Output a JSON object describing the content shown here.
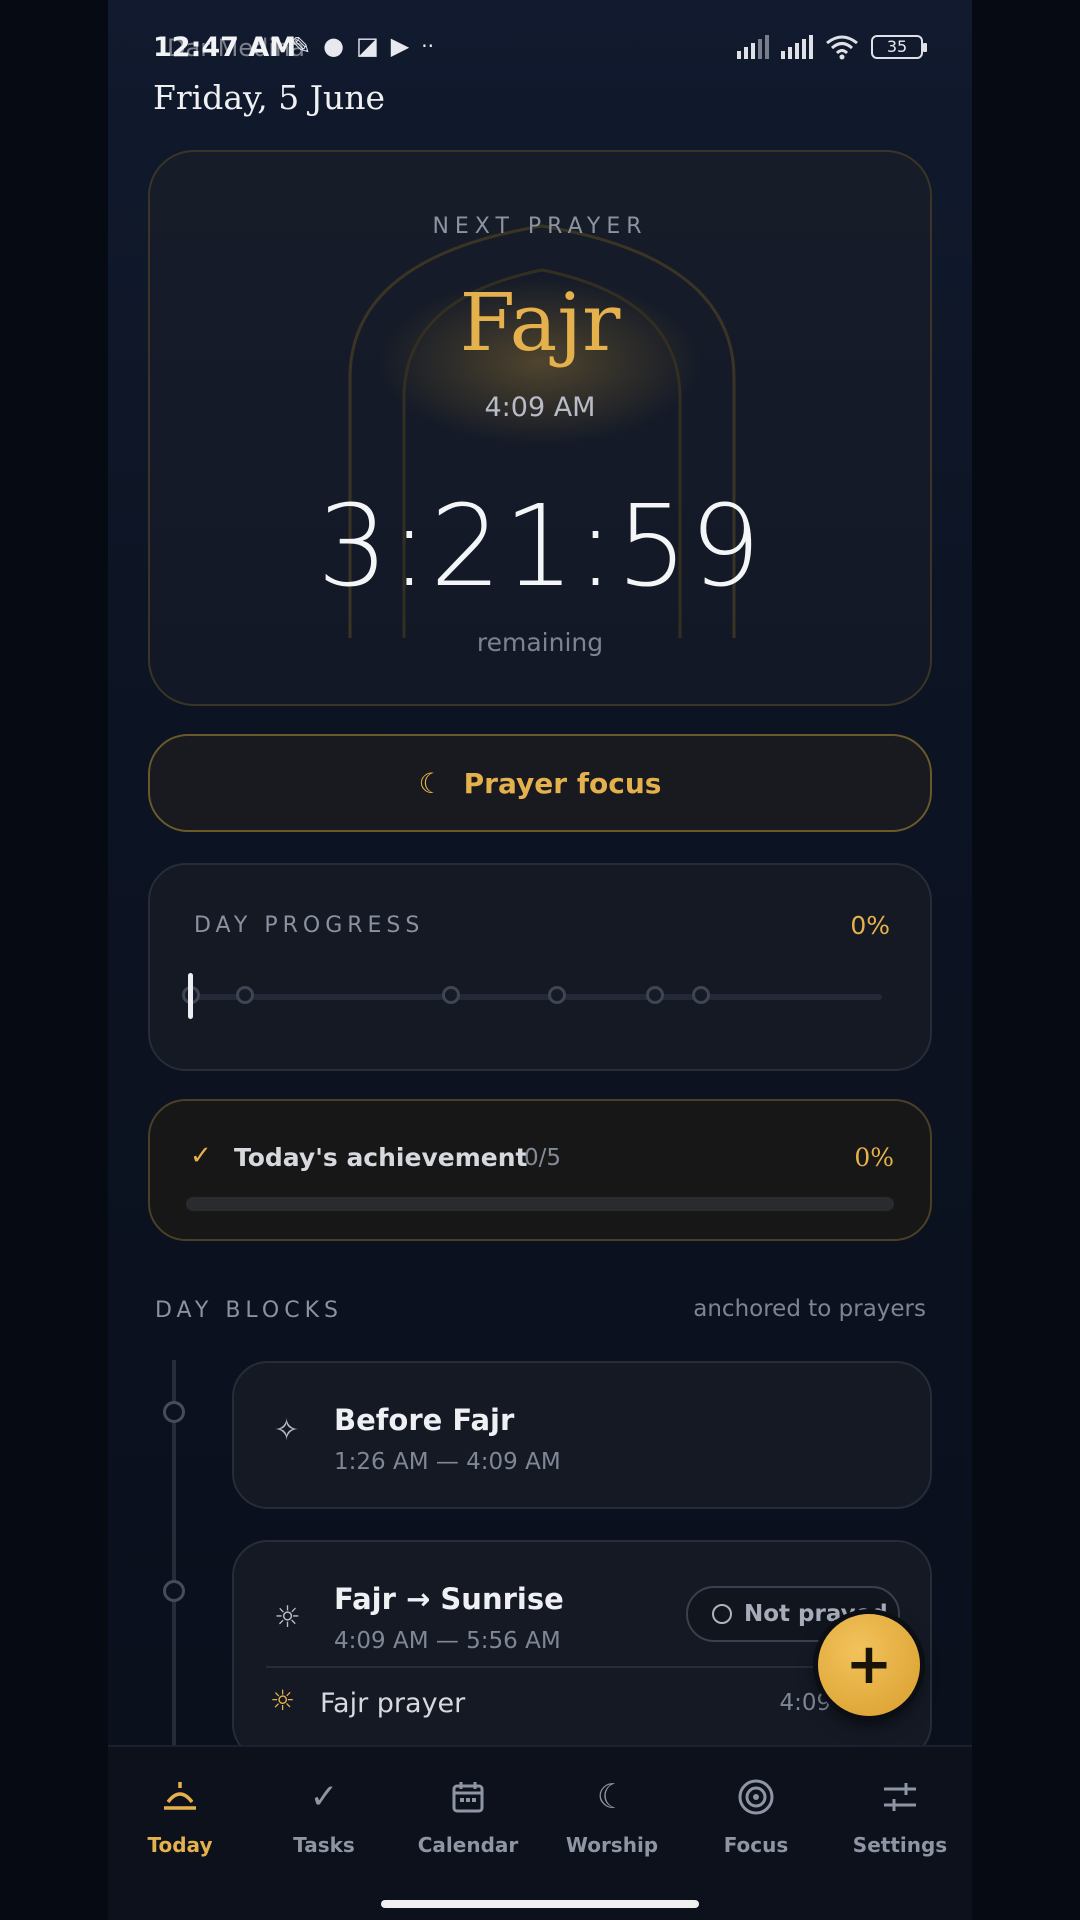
{
  "status_bar": {
    "time": "12:47 AM",
    "ghost_text": "Dar Mediha",
    "battery": "35"
  },
  "date": "Friday, 5 June",
  "next_prayer": {
    "label": "NEXT PRAYER",
    "name": "Fajr",
    "time": "4:09 AM",
    "countdown": "3:21:59",
    "remaining_label": "remaining"
  },
  "focus_button": {
    "label": "Prayer focus",
    "icon": "moon-icon"
  },
  "day_progress": {
    "title": "DAY PROGRESS",
    "percent": "0%",
    "progress_value": 0
  },
  "achievement": {
    "title": "Today's achievement",
    "count": "0/5",
    "percent": "0%",
    "progress_value": 0
  },
  "day_blocks": {
    "title": "DAY BLOCKS",
    "subtitle": "anchored to prayers",
    "blocks": [
      {
        "name": "Before Fajr",
        "time": "1:26 AM — 4:09 AM",
        "icon": "sparkles-icon"
      },
      {
        "name": "Fajr → Sunrise",
        "time": "4:09 AM — 5:56 AM",
        "icon": "sunrise-icon",
        "status": "Not prayed",
        "sub_item": {
          "name": "Fajr prayer",
          "time": "4:09 AM"
        }
      }
    ]
  },
  "fab": {
    "label": "+"
  },
  "nav": {
    "items": [
      {
        "label": "Today",
        "icon": "sunrise-icon",
        "active": true
      },
      {
        "label": "Tasks",
        "icon": "check-icon"
      },
      {
        "label": "Calendar",
        "icon": "calendar-icon"
      },
      {
        "label": "Worship",
        "icon": "moon-icon"
      },
      {
        "label": "Focus",
        "icon": "target-icon"
      },
      {
        "label": "Settings",
        "icon": "sliders-icon"
      }
    ]
  },
  "colors": {
    "accent": "#e5b14c",
    "background": "#0c1322",
    "card": "#141924"
  }
}
